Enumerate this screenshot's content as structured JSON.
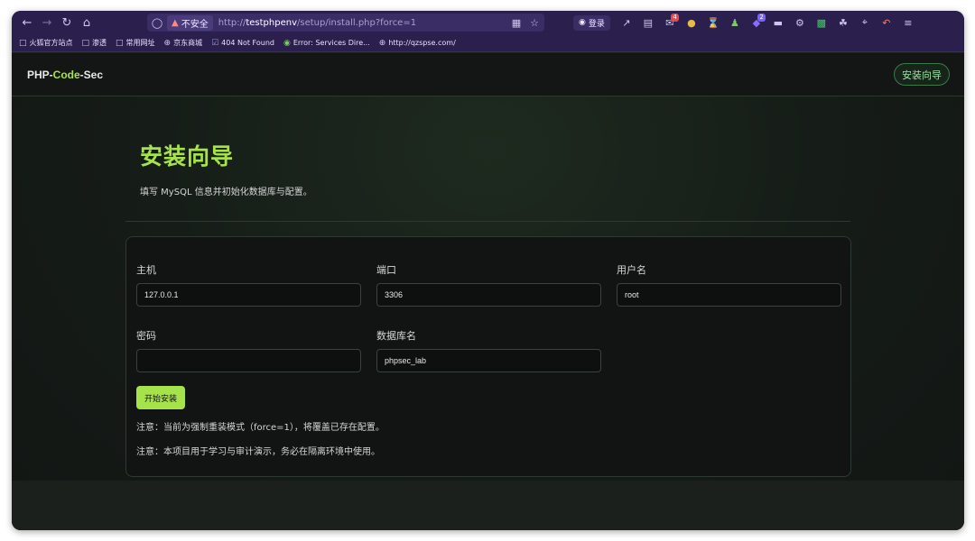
{
  "browser": {
    "url_insecure_label": "不安全",
    "url_scheme": "http://",
    "url_host": "testphpenv",
    "url_path": "/setup/install.php?force=1",
    "login_label": "登录",
    "ext_badge_1": "4",
    "ext_badge_2": "2",
    "icons": [
      "back-icon",
      "forward-icon",
      "reload-icon",
      "home-icon",
      "shield-icon",
      "lock-icon",
      "qr-icon",
      "star-icon"
    ]
  },
  "bookmarks": [
    {
      "label": "火狐官方站点",
      "icon": "folder-icon"
    },
    {
      "label": "渗透",
      "icon": "folder-icon"
    },
    {
      "label": "常用网址",
      "icon": "folder-icon"
    },
    {
      "label": "京东商城",
      "icon": "globe-icon"
    },
    {
      "label": "404 Not Found",
      "icon": "checkbox-icon"
    },
    {
      "label": "Error: Services Dire...",
      "icon": "site-icon"
    },
    {
      "label": "http://qzspse.com/",
      "icon": "globe-icon"
    }
  ],
  "app": {
    "brand_part1": "PHP-",
    "brand_part2": "Code",
    "brand_part3": "-Sec",
    "brand_accent": "#a6e34a",
    "wizard_button": "安装向导"
  },
  "hero": {
    "title": "安装向导",
    "subtitle": "填写 MySQL 信息并初始化数据库与配置。"
  },
  "form": {
    "host_label": "主机",
    "host_value": "127.0.0.1",
    "port_label": "端口",
    "port_value": "3306",
    "user_label": "用户名",
    "user_value": "root",
    "password_label": "密码",
    "password_value": "",
    "dbname_label": "数据库名",
    "dbname_value": "phpsec_lab",
    "install_button": "开始安装",
    "note_force": "注意：当前为强制重装模式（force=1），将覆盖已存在配置。",
    "note_usage": "注意：本项目用于学习与审计演示，务必在隔离环境中使用。"
  }
}
